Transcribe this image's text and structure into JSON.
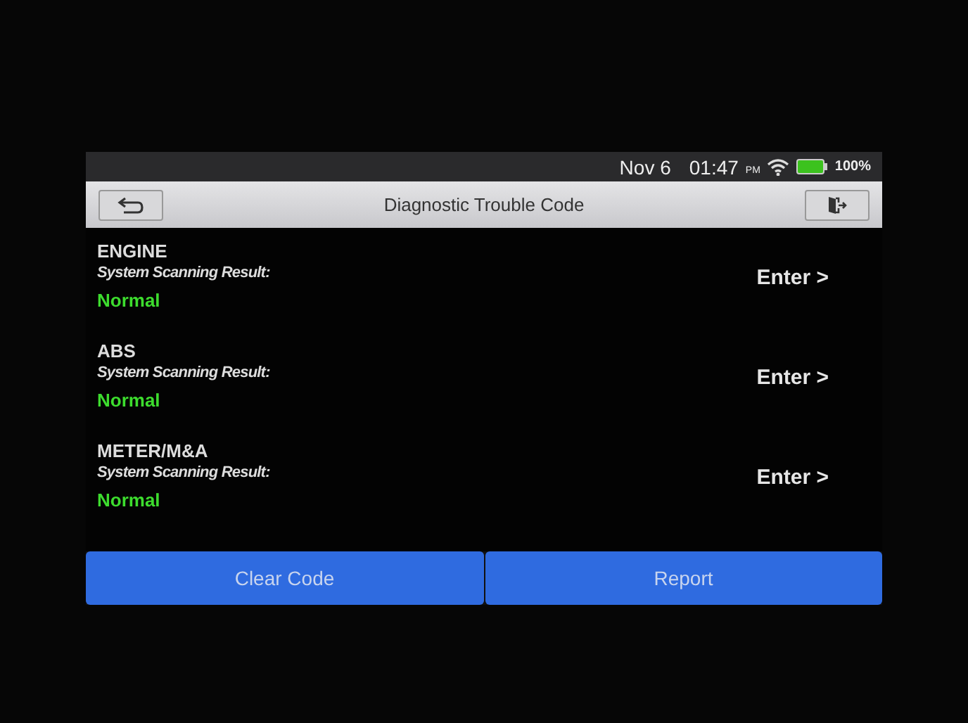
{
  "status_bar": {
    "date": "Nov 6",
    "time": "01:47",
    "ampm": "PM",
    "battery": "100%"
  },
  "header": {
    "title": "Diagnostic Trouble Code"
  },
  "systems": [
    {
      "name": "ENGINE",
      "label": "System Scanning Result:",
      "result": "Normal",
      "color": "#3ddc2e",
      "action": "Enter >"
    },
    {
      "name": "ABS",
      "label": "System Scanning Result:",
      "result": "Normal",
      "color": "#3ddc2e",
      "action": "Enter >"
    },
    {
      "name": "METER/M&A",
      "label": "System Scanning Result:",
      "result": "Normal",
      "color": "#3ddc2e",
      "action": "Enter >"
    }
  ],
  "buttons": [
    "Clear Code",
    "Report"
  ]
}
